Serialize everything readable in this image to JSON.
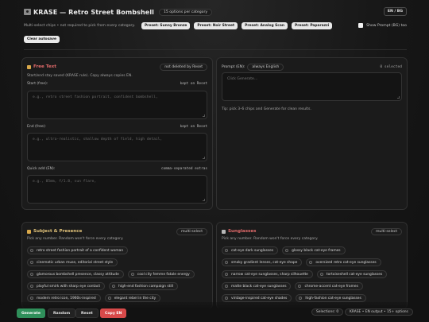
{
  "header": {
    "title": "KRASE — Retro Street Bombshell",
    "options_badge": "15 options per category",
    "lang_button": "EN / BG"
  },
  "toolbar": {
    "hint": "Multi-select chips • not required to pick from every category.",
    "presets": [
      "Preset: Sunny Bronze",
      "Preset: Noir Street",
      "Preset: Analog Scan",
      "Preset: Paparazzi"
    ],
    "show_prompt_label": "Show Prompt (BG) too",
    "clear_autosave": "Clear autosave"
  },
  "free_text": {
    "title": "Free Text",
    "badge": "not deleted by Reset",
    "subtitle": "Start/end stay saved (KRASE rule). Copy always copies EN.",
    "start_label": "Start (free):",
    "start_note": "kept on Reset",
    "start_placeholder": "e.g., retro street fashion portrait, confident bombshell,",
    "end_label": "End (free):",
    "end_note": "kept on Reset",
    "end_placeholder": "e.g., ultra-realistic, shallow depth of field, high detail,",
    "quick_label": "Quick add (EN):",
    "quick_note": "comma-separated extras",
    "quick_placeholder": "e.g., 85mm, f/1.8, sun flare,"
  },
  "prompt": {
    "label": "Prompt (EN):",
    "badge": "always English",
    "selected": "0 selected",
    "placeholder": "Click Generate...",
    "tip": "Tip: pick 3–6 chips and Generate for clean results."
  },
  "subject": {
    "title": "Subject & Presence",
    "badge": "multi-select",
    "subtitle": "Pick any number. Random won't force every category.",
    "chips": [
      [
        "retro street fashion portrait of a confident woman"
      ],
      [
        "cinematic urban muse, editorial street style"
      ],
      [
        "glamorous bombshell presence, classy attitude",
        "cool city femme fatale energy"
      ],
      [
        "playful smirk with sharp eye contact",
        "high-end fashion campaign still"
      ],
      [
        "modern retro icon, 1960s-inspired",
        "elegant rebel in the city"
      ]
    ]
  },
  "sunglasses": {
    "title": "Sunglasses",
    "badge": "multi-select",
    "subtitle": "Pick any number. Random won't force every category.",
    "chips": [
      [
        "cat-eye dark sunglasses",
        "glossy black cat-eye frames"
      ],
      [
        "smoky gradient lenses, cat-eye shape",
        "oversized retro cat-eye sunglasses"
      ],
      [
        "narrow cat-eye sunglasses, sharp silhouette",
        "tortoiseshell cat-eye sunglasses"
      ],
      [
        "matte black cat-eye sunglasses",
        "chrome-accent cat-eye frames"
      ],
      [
        "vintage-inspired cat-eye shades",
        "high-fashion cat-eye sunglasses"
      ]
    ]
  },
  "bottom": {
    "generate": "Generate",
    "random": "Random",
    "reset": "Reset",
    "copy": "Copy EN",
    "selections": "Selections: 0",
    "status_badge": "KRASE • EN output • 15+ options"
  },
  "colors": {
    "free_text_title": "#e06a6a",
    "subject_title": "#e2c37a",
    "sunglasses_title": "#e06a6a",
    "generate": "#2f8f5a",
    "copy": "#d84a4a"
  }
}
